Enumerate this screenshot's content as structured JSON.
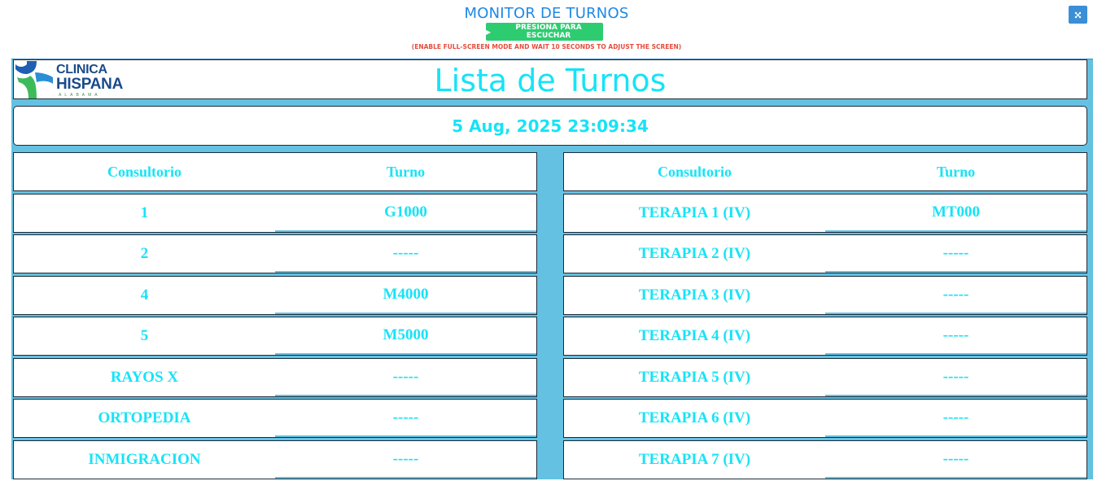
{
  "topbar": {
    "title": "MONITOR DE TURNOS",
    "play_label": "PRESIONA PARA ESCUCHAR",
    "hint": "(ENABLE FULL-SCREEN MODE AND WAIT 10 SECONDS TO ADJUST THE SCREEN)",
    "fullscreen_icon": "expand-icon"
  },
  "logo": {
    "line1": "CLINICA",
    "line2": "HISPANA",
    "line3": "ALABAMA"
  },
  "page_title": "Lista de Turnos",
  "datetime": "5 Aug, 2025 23:09:34",
  "columns": {
    "room": "Consultorio",
    "ticket": "Turno"
  },
  "left_rows": [
    {
      "room": "1",
      "ticket": "G1000"
    },
    {
      "room": "2",
      "ticket": "-----"
    },
    {
      "room": "4",
      "ticket": "M4000"
    },
    {
      "room": "5",
      "ticket": "M5000"
    },
    {
      "room": "RAYOS X",
      "ticket": "-----"
    },
    {
      "room": "ORTOPEDIA",
      "ticket": "-----"
    },
    {
      "room": "INMIGRACION",
      "ticket": "-----"
    }
  ],
  "right_rows": [
    {
      "room": "TERAPIA 1 (IV)",
      "ticket": "MT000"
    },
    {
      "room": "TERAPIA 2 (IV)",
      "ticket": "-----"
    },
    {
      "room": "TERAPIA 3 (IV)",
      "ticket": "-----"
    },
    {
      "room": "TERAPIA 4 (IV)",
      "ticket": "-----"
    },
    {
      "room": "TERAPIA 5 (IV)",
      "ticket": "-----"
    },
    {
      "room": "TERAPIA 6 (IV)",
      "ticket": "-----"
    },
    {
      "room": "TERAPIA 7 (IV)",
      "ticket": "-----"
    }
  ],
  "colors": {
    "accent_cyan": "#17e3f6",
    "panel_blue": "#64c1e1",
    "play_green": "#2ecc71",
    "hint_red": "#e74c3c"
  }
}
